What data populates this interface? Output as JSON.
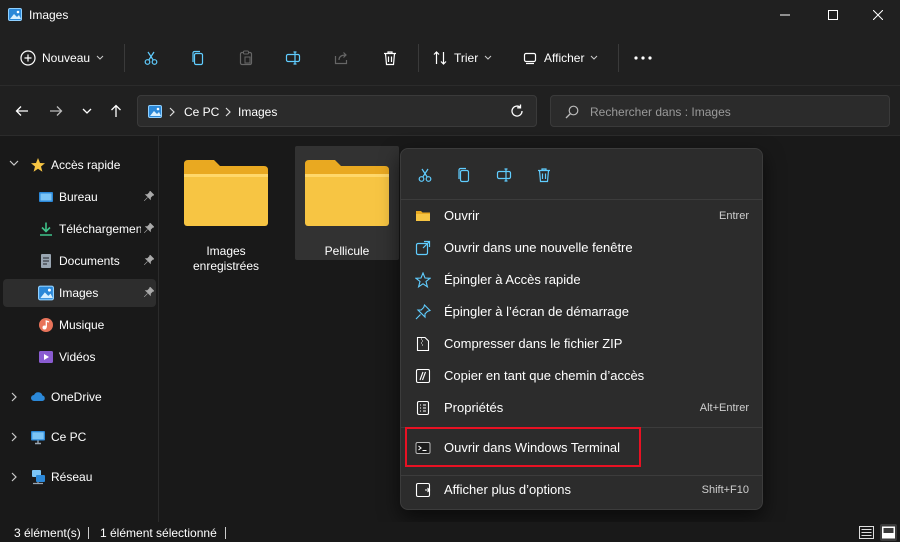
{
  "window": {
    "title": "Images"
  },
  "colors": {
    "accent": "#60cdff",
    "folder": "#f7c543",
    "highlight": "#e81123"
  },
  "toolbar": {
    "new_label": "Nouveau",
    "sort_label": "Trier",
    "view_label": "Afficher",
    "icons": [
      "cut-icon",
      "copy-icon",
      "paste-icon",
      "rename-icon",
      "share-icon",
      "delete-icon",
      "more-icon"
    ]
  },
  "address": {
    "crumbs": [
      "Ce PC",
      "Images"
    ],
    "search_placeholder": "Rechercher dans : Images"
  },
  "sidebar": {
    "items": [
      {
        "label": "Accès rapide",
        "icon": "star-icon"
      },
      {
        "label": "Bureau",
        "icon": "desktop-icon"
      },
      {
        "label": "Téléchargements",
        "icon": "download-icon"
      },
      {
        "label": "Documents",
        "icon": "documents-icon"
      },
      {
        "label": "Images",
        "icon": "images-icon"
      },
      {
        "label": "Musique",
        "icon": "music-icon"
      },
      {
        "label": "Vidéos",
        "icon": "videos-icon"
      },
      {
        "label": "OneDrive",
        "icon": "cloud-icon"
      },
      {
        "label": "Ce PC",
        "icon": "computer-icon"
      },
      {
        "label": "Réseau",
        "icon": "network-icon"
      }
    ]
  },
  "content": {
    "folders": [
      {
        "label": "Images enregistrées"
      },
      {
        "label": "Pellicule",
        "selected": true
      }
    ]
  },
  "context_menu": {
    "items": [
      {
        "label": "Ouvrir",
        "shortcut": "Entrer"
      },
      {
        "label": "Ouvrir dans une nouvelle fenêtre",
        "shortcut": ""
      },
      {
        "label": "Épingler à Accès rapide",
        "shortcut": ""
      },
      {
        "label": "Épingler à l’écran de démarrage",
        "shortcut": ""
      },
      {
        "label": "Compresser dans le fichier ZIP",
        "shortcut": ""
      },
      {
        "label": "Copier en tant que chemin d’accès",
        "shortcut": ""
      },
      {
        "label": "Propriétés",
        "shortcut": "Alt+Entrer"
      },
      {
        "label": "Ouvrir dans Windows Terminal",
        "shortcut": ""
      },
      {
        "label": "Afficher plus d’options",
        "shortcut": "Shift+F10"
      }
    ]
  },
  "status": {
    "count": "3 élément(s)",
    "selected": "1 élément sélectionné"
  }
}
